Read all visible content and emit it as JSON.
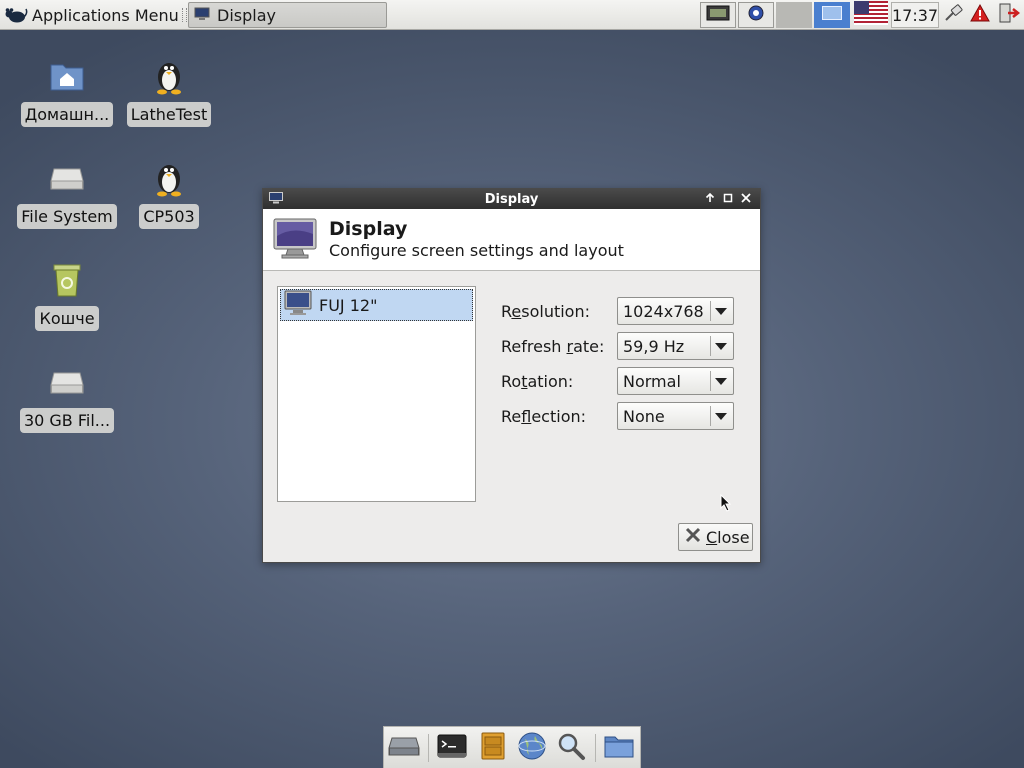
{
  "top_panel": {
    "apps_menu_label": "Applications Menu",
    "task_button_label": "Display",
    "clock": "17:37"
  },
  "desktop": {
    "icons": [
      {
        "label": "Домашн...",
        "icon": "home-folder-icon"
      },
      {
        "label": "LatheTest",
        "icon": "penguin-icon"
      },
      {
        "label": "File System",
        "icon": "drive-icon"
      },
      {
        "label": "CP503",
        "icon": "penguin-icon"
      },
      {
        "label": "Кошче",
        "icon": "trash-icon"
      },
      {
        "label": "30 GB Fil...",
        "icon": "drive-icon"
      }
    ]
  },
  "dialog": {
    "window_title": "Display",
    "header_title": "Display",
    "header_subtitle": "Configure screen settings and layout",
    "displays": [
      "FUJ 12\""
    ],
    "settings": [
      {
        "label_pre": "R",
        "label_key": "e",
        "label_post": "solution:",
        "value": "1024x768"
      },
      {
        "label_pre": "Refresh ",
        "label_key": "r",
        "label_post": "ate:",
        "value": "59,9 Hz"
      },
      {
        "label_pre": "Ro",
        "label_key": "t",
        "label_post": "ation:",
        "value": "Normal"
      },
      {
        "label_pre": "Re",
        "label_key": "f",
        "label_post": "lection:",
        "value": "None"
      }
    ],
    "close_button": {
      "key": "C",
      "rest": "lose"
    }
  },
  "dock": {
    "items": [
      "drive-icon",
      "terminal-icon",
      "file-cabinet-icon",
      "globe-icon",
      "search-icon",
      "folder-icon"
    ]
  },
  "colors": {
    "selection": "#c0d7f2",
    "workspace_active": "#4a7fcf",
    "titlebar": "#2f2f2f"
  }
}
